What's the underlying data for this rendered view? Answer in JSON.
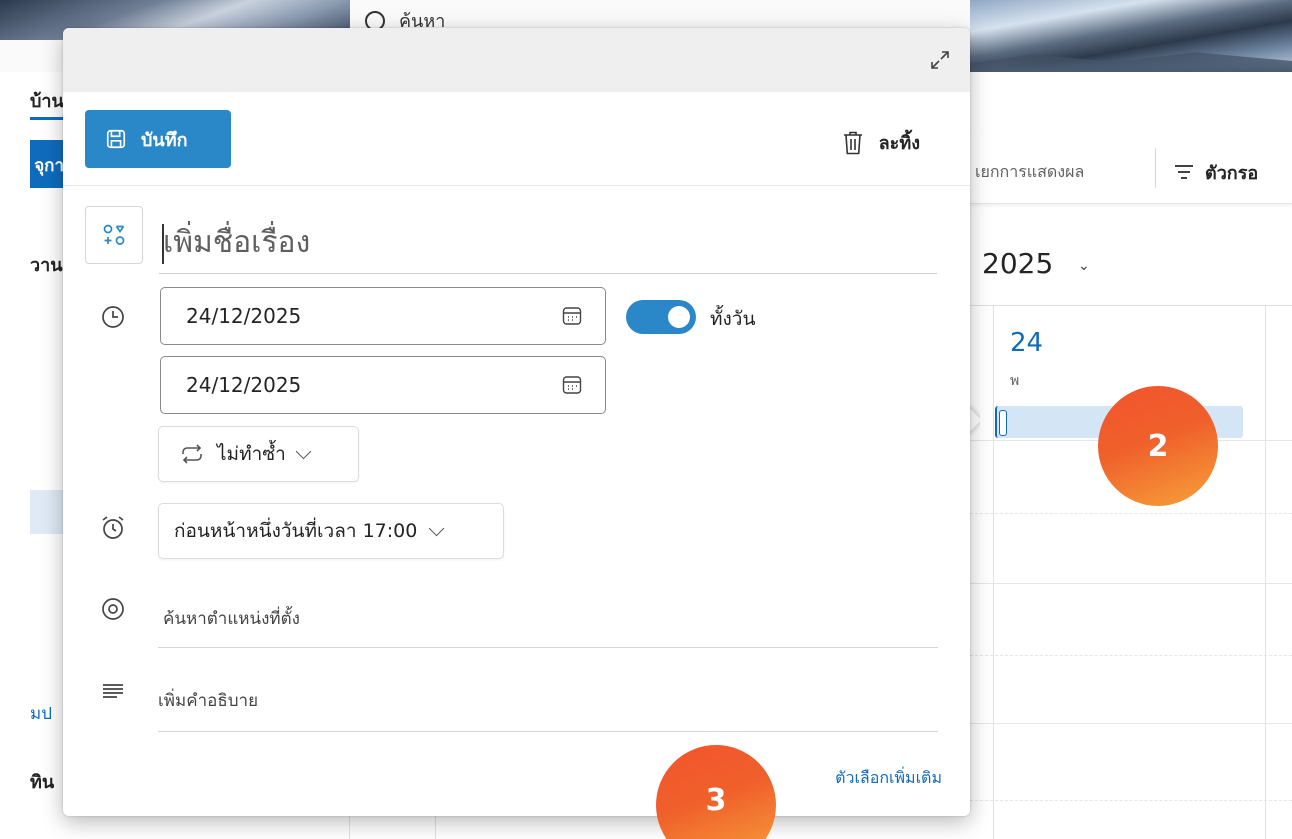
{
  "background": {
    "search_label": "ค้นหา",
    "tab_home": "บ้าน",
    "left_button": "จุกา",
    "left_label_1": "วาน",
    "left_label_2": "มป",
    "left_label_3": "ทิน",
    "view_options": "เยกการแสดงผล",
    "filter_label": "ตัวกรอ",
    "year": "2025",
    "day_number": "24",
    "day_weekday": "พ"
  },
  "popup": {
    "save_label": "บันทึก",
    "discard_label": "ละทิ้ง",
    "title_placeholder": "เพิ่มชื่อเรื่อง",
    "start_date": "24/12/2025",
    "end_date": "24/12/2025",
    "all_day_label": "ทั้งวัน",
    "all_day_on": true,
    "repeat_label": "ไม่ทำซ้ำ",
    "reminder_label": "ก่อนหน้าหนึ่งวันที่เวลา 17:00",
    "location_placeholder": "ค้นหาตำแหน่งที่ตั้ง",
    "description_placeholder": "เพิ่มคำอธิบาย",
    "more_options": "ตัวเลือกเพิ่มเติม"
  },
  "markers": {
    "step_2": "2",
    "step_3": "3"
  },
  "colors": {
    "accent": "#2b88c8",
    "link": "#0f6cbd",
    "marker_start": "#f2542d",
    "marker_end": "#f6a23a"
  }
}
